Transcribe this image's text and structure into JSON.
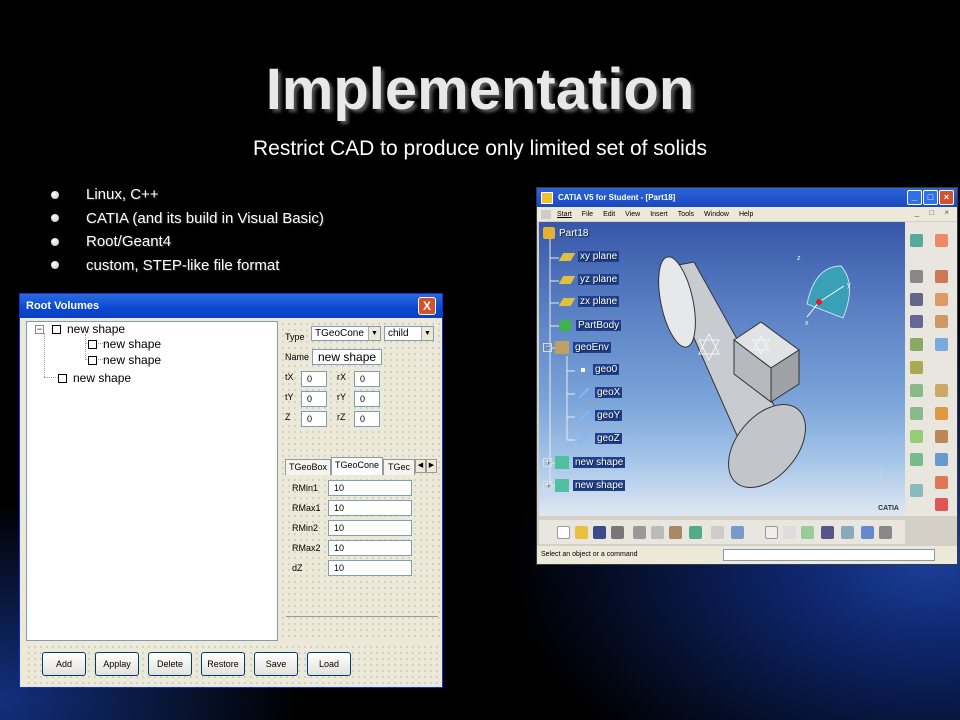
{
  "slide": {
    "title": "Implementation",
    "subtitle": "Restrict CAD to produce only limited set of solids",
    "bullets": [
      "Linux, C++",
      "CATIA (and its build in Visual Basic)",
      "Root/Geant4",
      "custom, STEP-like file format"
    ]
  },
  "root_volumes": {
    "window_title": "Root Volumes",
    "close_label": "X",
    "tree": {
      "expander": "−",
      "nodes": [
        "new shape",
        "new shape",
        "new shape",
        "new shape"
      ]
    },
    "props": {
      "type_label": "Type",
      "type_value": "TGeoCone",
      "child_value": "child",
      "name_label": "Name",
      "name_value": "new shape",
      "tx_label": "tX",
      "tx_value": "0",
      "ty_label": "tY",
      "ty_value": "0",
      "z_label": "Z",
      "z_value": "0",
      "rx_label": "rX",
      "rx_value": "0",
      "ry_label": "rY",
      "ry_value": "0",
      "rz_label": "rZ",
      "rz_value": "0",
      "tabs": [
        "TGeoBox",
        "TGeoCone",
        "TGec"
      ],
      "active_tab": "TGeoCone",
      "params": [
        {
          "label": "RMin1",
          "value": "10"
        },
        {
          "label": "RMax1",
          "value": "10"
        },
        {
          "label": "RMin2",
          "value": "10"
        },
        {
          "label": "RMax2",
          "value": "10"
        },
        {
          "label": "dZ",
          "value": "10"
        }
      ]
    },
    "buttons": [
      "Add",
      "Applay",
      "Delete",
      "Restore",
      "Save",
      "Load"
    ]
  },
  "catia": {
    "window_title": "CATIA V5 for Student - [Part18]",
    "menu": [
      "Start",
      "File",
      "Edit",
      "View",
      "Insert",
      "Tools",
      "Window",
      "Help"
    ],
    "tree": [
      {
        "label": "Part18"
      },
      {
        "label": "xy plane"
      },
      {
        "label": "yz plane"
      },
      {
        "label": "zx plane"
      },
      {
        "label": "PartBody"
      },
      {
        "label": "geoEnv"
      },
      {
        "label": "geo0"
      },
      {
        "label": "geoX"
      },
      {
        "label": "geoY"
      },
      {
        "label": "geoZ"
      },
      {
        "label": "new shape"
      },
      {
        "label": "new shape"
      }
    ],
    "status_text": "Select an object or a command",
    "axis_labels": {
      "x": "x",
      "y": "y",
      "z": "z"
    },
    "logo_text": "CATIA"
  },
  "colors": {
    "title_text": "#e8e8e8",
    "xp_titlebar": "#0a48d0",
    "xp_face": "#ece9d8",
    "catia_viewport_top": "#3757a8",
    "catia_viewport_bottom": "#dfe8f2"
  }
}
